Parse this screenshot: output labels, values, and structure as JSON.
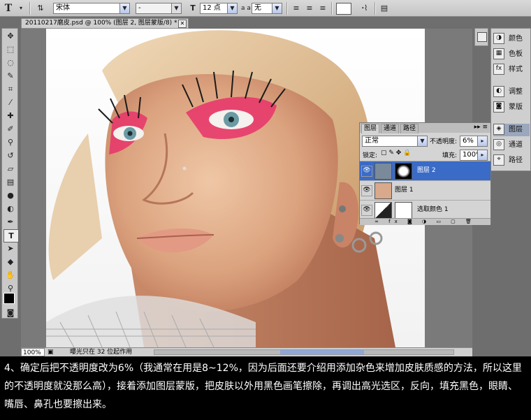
{
  "options_bar": {
    "tool_icon": "T",
    "font_family": "宋体",
    "font_style": "-",
    "font_size": "12 点",
    "aa_label": "a a",
    "antialias": "无"
  },
  "document": {
    "tab_title": "20110217磨皮.psd @ 100% (图层 2, 图层蒙版/8) *",
    "zoom": "100%",
    "status": "曝光只在 32 位起作用"
  },
  "dock": {
    "items": [
      {
        "icon": "swatch-icon",
        "label": "颜色"
      },
      {
        "icon": "grid-icon",
        "label": "色板"
      },
      {
        "icon": "fx-icon",
        "label": "样式"
      },
      {
        "icon": "adjust-icon",
        "label": "调整"
      },
      {
        "icon": "mask-icon",
        "label": "蒙版"
      },
      {
        "icon": "layers-icon",
        "label": "图层"
      },
      {
        "icon": "channels-icon",
        "label": "通道"
      },
      {
        "icon": "paths-icon",
        "label": "路径"
      }
    ]
  },
  "layers_panel": {
    "tabs": [
      "图层",
      "通道",
      "路径"
    ],
    "blend_mode": "正常",
    "opacity_label": "不透明度:",
    "opacity_value": "6%",
    "lock_label": "锁定:",
    "fill_label": "填充:",
    "fill_value": "100%",
    "layers": [
      {
        "name": "图层 2",
        "selected": true
      },
      {
        "name": "图层 1",
        "selected": false
      },
      {
        "name": "选取颜色 1",
        "selected": false
      }
    ]
  },
  "caption": {
    "text": "4、确定后把不透明度改为6%（我通常在用是8~12%，因为后面还要介绍用添加杂色来增加皮肤质感的方法，所以这里的不透明度就没那么高），接着添加图层蒙版，把皮肤以外用黑色画笔擦除，再调出高光选区，反向，填充黑色，眼睛、嘴唇、鼻孔也要擦出来。"
  },
  "colors": {
    "selection": "#3a6bc7",
    "accent_pink": "#e8336a"
  }
}
